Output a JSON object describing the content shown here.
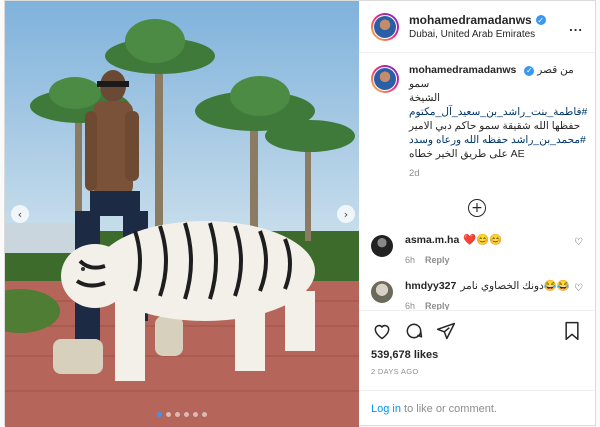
{
  "post": {
    "username": "mohamedramadanws",
    "location": "Dubai, United Arab Emirates",
    "more": "...",
    "caption": {
      "line1": "من قصر سمو",
      "line2": "الشيخة",
      "line3": "#فاطمة_بنت_راشد_بن_سعيد_آل_مكتوم",
      "line4": "حفظها الله شقيقة سمو حاكم دبي الامير",
      "line5": "#محمد_بن_راشد حفظه الله ورعاه وسدد",
      "line6": "AE على طريق الخير خطاه"
    },
    "caption_time": "2d",
    "comments": [
      {
        "user": "asma.m.ha",
        "text": "❤️😊😊",
        "time": "6h",
        "reply": "Reply"
      },
      {
        "user": "hmdyy327",
        "text": "دونك الخصاوي نامر😂😂",
        "time": "6h",
        "reply": "Reply"
      }
    ],
    "likes": "539,678 likes",
    "date": "2 DAYS AGO",
    "login": {
      "link": "Log in",
      "rest": " to like or comment."
    }
  },
  "carousel": {
    "count": 6,
    "active": 0
  },
  "colors": {
    "accent": "#3897f0",
    "hashtag": "#00376b",
    "link": "#0095f6"
  },
  "icons": [
    "heart-icon",
    "comment-icon",
    "share-icon",
    "bookmark-icon",
    "plus-circle-icon",
    "verified-badge-icon",
    "more-options-icon"
  ]
}
